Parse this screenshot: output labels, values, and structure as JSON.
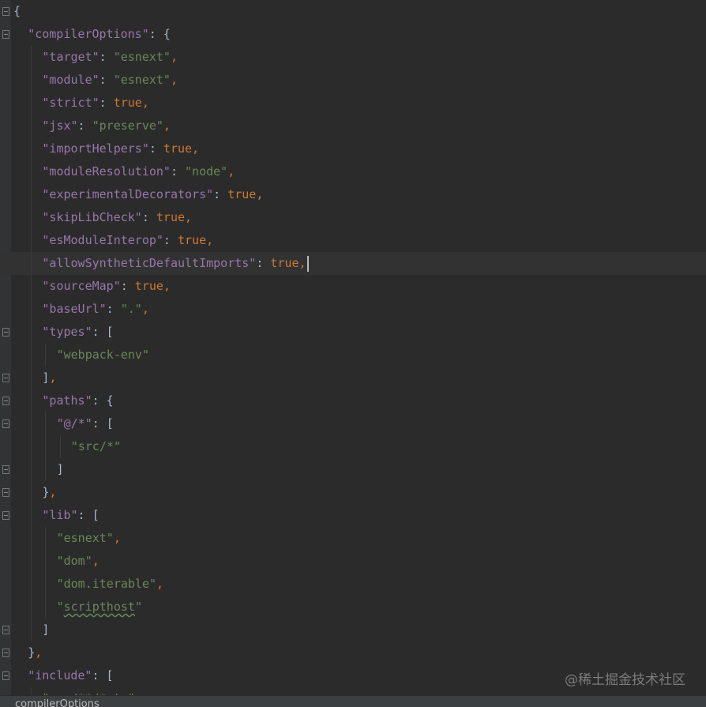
{
  "editor": {
    "lines": [
      {
        "indent": 0,
        "fold": "open",
        "tokens": [
          {
            "t": "{",
            "c": "punc"
          }
        ]
      },
      {
        "indent": 1,
        "fold": "open",
        "tokens": [
          {
            "t": "\"compilerOptions\"",
            "c": "key"
          },
          {
            "t": ": {",
            "c": "punc"
          }
        ]
      },
      {
        "indent": 2,
        "tokens": [
          {
            "t": "\"target\"",
            "c": "key"
          },
          {
            "t": ": ",
            "c": "punc"
          },
          {
            "t": "\"esnext\"",
            "c": "str"
          },
          {
            "t": ",",
            "c": "kw"
          }
        ]
      },
      {
        "indent": 2,
        "tokens": [
          {
            "t": "\"module\"",
            "c": "key"
          },
          {
            "t": ": ",
            "c": "punc"
          },
          {
            "t": "\"esnext\"",
            "c": "str"
          },
          {
            "t": ",",
            "c": "kw"
          }
        ]
      },
      {
        "indent": 2,
        "tokens": [
          {
            "t": "\"strict\"",
            "c": "key"
          },
          {
            "t": ": ",
            "c": "punc"
          },
          {
            "t": "true",
            "c": "kw"
          },
          {
            "t": ",",
            "c": "kw"
          }
        ]
      },
      {
        "indent": 2,
        "tokens": [
          {
            "t": "\"jsx\"",
            "c": "key"
          },
          {
            "t": ": ",
            "c": "punc"
          },
          {
            "t": "\"preserve\"",
            "c": "str"
          },
          {
            "t": ",",
            "c": "kw"
          }
        ]
      },
      {
        "indent": 2,
        "tokens": [
          {
            "t": "\"importHelpers\"",
            "c": "key"
          },
          {
            "t": ": ",
            "c": "punc"
          },
          {
            "t": "true",
            "c": "kw"
          },
          {
            "t": ",",
            "c": "kw"
          }
        ]
      },
      {
        "indent": 2,
        "tokens": [
          {
            "t": "\"moduleResolution\"",
            "c": "key"
          },
          {
            "t": ": ",
            "c": "punc"
          },
          {
            "t": "\"node\"",
            "c": "str"
          },
          {
            "t": ",",
            "c": "kw"
          }
        ]
      },
      {
        "indent": 2,
        "tokens": [
          {
            "t": "\"experimentalDecorators\"",
            "c": "key"
          },
          {
            "t": ": ",
            "c": "punc"
          },
          {
            "t": "true",
            "c": "kw"
          },
          {
            "t": ",",
            "c": "kw"
          }
        ]
      },
      {
        "indent": 2,
        "tokens": [
          {
            "t": "\"skipLibCheck\"",
            "c": "key"
          },
          {
            "t": ": ",
            "c": "punc"
          },
          {
            "t": "true",
            "c": "kw"
          },
          {
            "t": ",",
            "c": "kw"
          }
        ]
      },
      {
        "indent": 2,
        "tokens": [
          {
            "t": "\"esModuleInterop\"",
            "c": "key"
          },
          {
            "t": ": ",
            "c": "punc"
          },
          {
            "t": "true",
            "c": "kw"
          },
          {
            "t": ",",
            "c": "kw"
          }
        ]
      },
      {
        "indent": 2,
        "current": true,
        "caret": true,
        "tokens": [
          {
            "t": "\"allowSyntheticDefaultImports\"",
            "c": "key"
          },
          {
            "t": ": ",
            "c": "punc"
          },
          {
            "t": "true",
            "c": "kw"
          },
          {
            "t": ",",
            "c": "kw"
          }
        ]
      },
      {
        "indent": 2,
        "tokens": [
          {
            "t": "\"sourceMap\"",
            "c": "key"
          },
          {
            "t": ": ",
            "c": "punc"
          },
          {
            "t": "true",
            "c": "kw"
          },
          {
            "t": ",",
            "c": "kw"
          }
        ]
      },
      {
        "indent": 2,
        "tokens": [
          {
            "t": "\"baseUrl\"",
            "c": "key"
          },
          {
            "t": ": ",
            "c": "punc"
          },
          {
            "t": "\".\"",
            "c": "str"
          },
          {
            "t": ",",
            "c": "kw"
          }
        ]
      },
      {
        "indent": 2,
        "fold": "open",
        "tokens": [
          {
            "t": "\"types\"",
            "c": "key"
          },
          {
            "t": ": [",
            "c": "punc"
          }
        ]
      },
      {
        "indent": 3,
        "tokens": [
          {
            "t": "\"webpack-env\"",
            "c": "str"
          }
        ]
      },
      {
        "indent": 2,
        "fold": "close",
        "tokens": [
          {
            "t": "]",
            "c": "punc"
          },
          {
            "t": ",",
            "c": "kw"
          }
        ]
      },
      {
        "indent": 2,
        "fold": "open",
        "tokens": [
          {
            "t": "\"paths\"",
            "c": "key"
          },
          {
            "t": ": {",
            "c": "punc"
          }
        ]
      },
      {
        "indent": 3,
        "fold": "open",
        "tokens": [
          {
            "t": "\"@/*\"",
            "c": "key"
          },
          {
            "t": ": [",
            "c": "punc"
          }
        ]
      },
      {
        "indent": 4,
        "tokens": [
          {
            "t": "\"src/*\"",
            "c": "str"
          }
        ]
      },
      {
        "indent": 3,
        "fold": "close",
        "tokens": [
          {
            "t": "]",
            "c": "punc"
          }
        ]
      },
      {
        "indent": 2,
        "fold": "close",
        "tokens": [
          {
            "t": "}",
            "c": "punc"
          },
          {
            "t": ",",
            "c": "kw"
          }
        ]
      },
      {
        "indent": 2,
        "fold": "open",
        "tokens": [
          {
            "t": "\"lib\"",
            "c": "key"
          },
          {
            "t": ": [",
            "c": "punc"
          }
        ]
      },
      {
        "indent": 3,
        "tokens": [
          {
            "t": "\"esnext\"",
            "c": "str"
          },
          {
            "t": ",",
            "c": "kw"
          }
        ]
      },
      {
        "indent": 3,
        "tokens": [
          {
            "t": "\"dom\"",
            "c": "str"
          },
          {
            "t": ",",
            "c": "kw"
          }
        ]
      },
      {
        "indent": 3,
        "tokens": [
          {
            "t": "\"dom.iterable\"",
            "c": "str"
          },
          {
            "t": ",",
            "c": "kw"
          }
        ]
      },
      {
        "indent": 3,
        "tokens": [
          {
            "t": "\"",
            "c": "str"
          },
          {
            "t": "scripthost",
            "c": "str typo"
          },
          {
            "t": "\"",
            "c": "str"
          }
        ]
      },
      {
        "indent": 2,
        "fold": "close",
        "tokens": [
          {
            "t": "]",
            "c": "punc"
          }
        ]
      },
      {
        "indent": 1,
        "fold": "close",
        "tokens": [
          {
            "t": "}",
            "c": "punc"
          },
          {
            "t": ",",
            "c": "kw"
          }
        ]
      },
      {
        "indent": 1,
        "fold": "open",
        "tokens": [
          {
            "t": "\"include\"",
            "c": "key"
          },
          {
            "t": ": [",
            "c": "punc"
          }
        ]
      },
      {
        "indent": 2,
        "tokens": [
          {
            "t": "\"src/**/*.ts\"",
            "c": "str"
          },
          {
            "t": ",",
            "c": "kw"
          }
        ]
      }
    ]
  },
  "breadcrumb": {
    "path": "compilerOptions"
  },
  "watermark": {
    "text": "@稀土掘金技术社区"
  }
}
